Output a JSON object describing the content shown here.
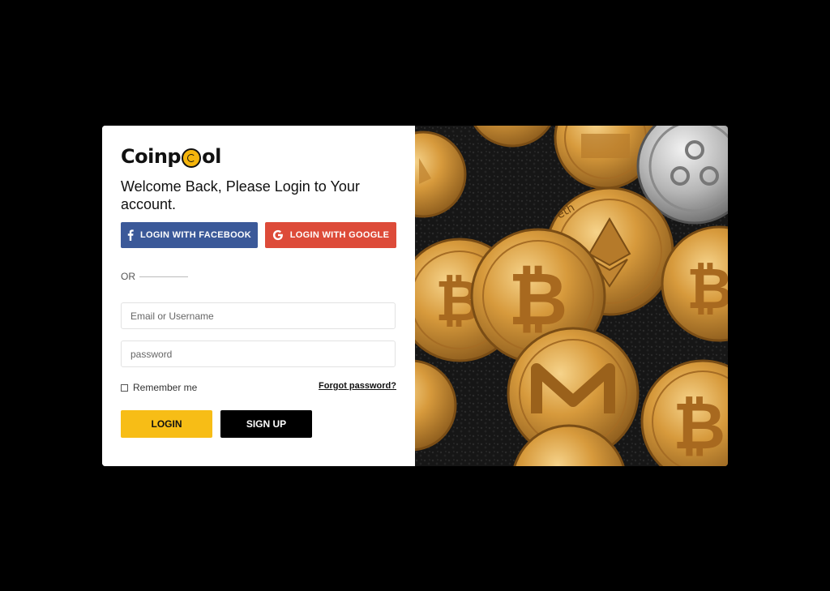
{
  "brand": {
    "name_prefix": "Coinp",
    "name_suffix": "ol"
  },
  "welcome": "Welcome Back, Please Login to Your account.",
  "social": {
    "facebook_label": "LOGIN WITH FACEBOOK",
    "google_label": "LOGIN WITH GOOGLE"
  },
  "divider": "OR",
  "form": {
    "email_placeholder": "Email or Username",
    "password_placeholder": "password",
    "remember_label": "Remember me",
    "forgot_label": "Forgot password?",
    "login_label": "LOGIN",
    "signup_label": "SIGN UP"
  },
  "coins_image": {
    "coins": [
      {
        "type": "ethereum",
        "label": "eth"
      },
      {
        "type": "bitcoin"
      },
      {
        "type": "ripple"
      },
      {
        "type": "monero"
      }
    ]
  },
  "colors": {
    "facebook": "#3b5999",
    "google": "#dd4b39",
    "accent": "#f7bd16",
    "coin_gold": "#d79a3c"
  }
}
